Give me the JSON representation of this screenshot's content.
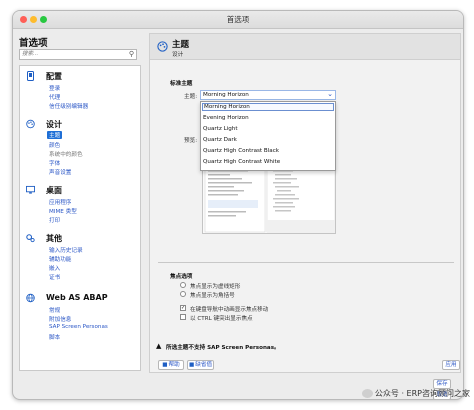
{
  "window": {
    "title": "首选项"
  },
  "sidebar": {
    "title": "首选项",
    "search_placeholder": "搜索...",
    "groups": [
      {
        "title": "配置",
        "icon": "phone-icon",
        "items": [
          "登录",
          "代理",
          "信任级别编辑器"
        ]
      },
      {
        "title": "设计",
        "icon": "palette-icon",
        "items": [
          "主题",
          "颜色",
          "系统中的颜色",
          "字体",
          "声音设置"
        ]
      },
      {
        "title": "桌面",
        "icon": "monitor-icon",
        "items": [
          "应用程序",
          "MIME 类型",
          "打印"
        ]
      },
      {
        "title": "其他",
        "icon": "gears-icon",
        "items": [
          "输入历史记录",
          "辅助功能",
          "嵌入",
          "证书"
        ]
      },
      {
        "title": "Web AS ABAP",
        "icon": "globe-icon",
        "items": [
          "常规",
          "附加信息",
          "SAP Screen Personas",
          "脚本"
        ]
      }
    ],
    "selected_item": "主题"
  },
  "panel": {
    "title": "主题",
    "subtitle": "设计",
    "standard_theme_label": "标准主题",
    "theme_label": "主题:",
    "theme_value": "Morning Horizon",
    "theme_options": [
      "Morning Horizon",
      "Evening Horizon",
      "Quartz Light",
      "Quartz Dark",
      "Quartz High Contrast Black",
      "Quartz High Contrast White"
    ],
    "preview_label": "预览:",
    "focus_section": "焦点选项",
    "focus_radio_1": "焦点显示为虚线矩形",
    "focus_radio_2": "焦点显示为角括号",
    "check_1": "在键盘导航中动画显示焦点移动",
    "check_2": "以 CTRL 键突出显示焦点",
    "warning": "所选主题不支持 SAP Screen Personas。",
    "help_button": "帮助",
    "defaults_button": "缺省值",
    "apply_button": "应用"
  },
  "footer": {
    "save_button": "保存",
    "cancel_button": "取消"
  },
  "watermark": "公众号 · ERP咨询顾问之家",
  "colors": {
    "accent": "#1f6fd6",
    "link": "#2a56c6"
  }
}
